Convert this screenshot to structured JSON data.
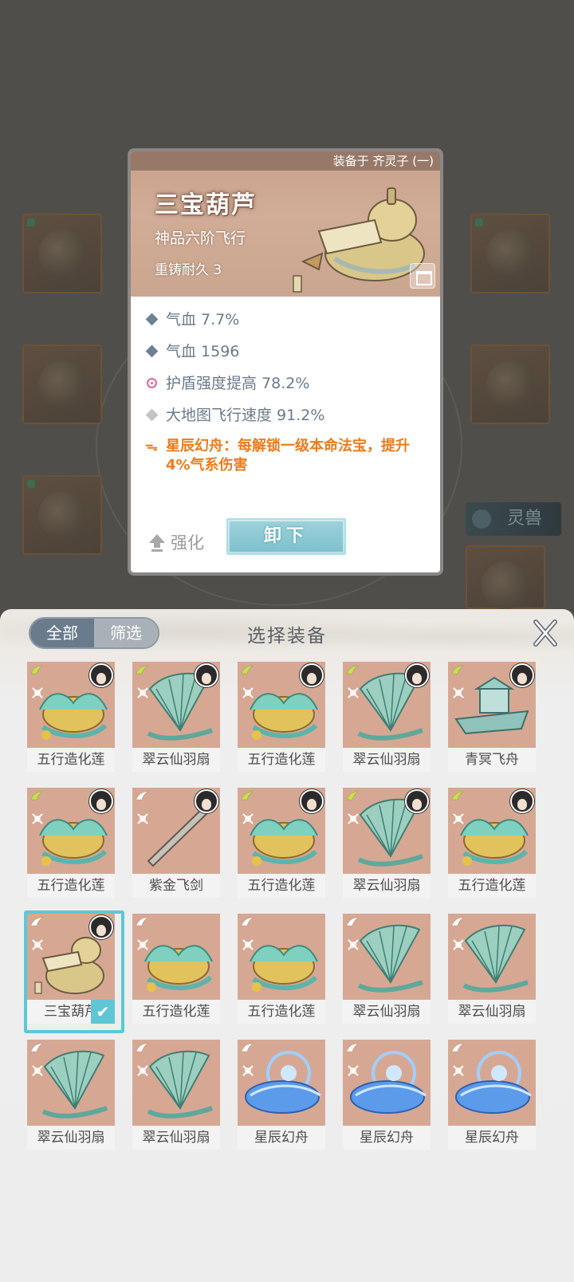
{
  "detail": {
    "equipped_on": "装备于 齐灵子 (一)",
    "name": "三宝葫芦",
    "grade": "神品六阶飞行",
    "durability": "重铸耐久 3",
    "attributes": [
      {
        "marker": "diamond",
        "text": "气血 7.7%"
      },
      {
        "marker": "diamond",
        "text": "气血 1596"
      },
      {
        "marker": "shield",
        "text": "护盾强度提高 78.2%"
      },
      {
        "marker": "diamond-gray",
        "text": "大地图飞行速度 91.2%"
      }
    ],
    "special": "星辰幻舟：每解锁一级本命法宝，提升4%气系伤害",
    "enhance_label": "强化",
    "unequip_label": "卸下"
  },
  "background": {
    "lingshou_label": "灵兽"
  },
  "panel": {
    "tab_all": "全部",
    "tab_filter": "筛选",
    "title": "选择装备",
    "items": [
      {
        "name": "五行造化莲",
        "wing": "#c6e24a",
        "avatar": true,
        "kind": "lotus"
      },
      {
        "name": "翠云仙羽扇",
        "wing": "#c6e24a",
        "avatar": true,
        "kind": "fan"
      },
      {
        "name": "五行造化莲",
        "wing": "#c6e24a",
        "avatar": true,
        "kind": "lotus"
      },
      {
        "name": "翠云仙羽扇",
        "wing": "#c6e24a",
        "avatar": true,
        "kind": "fan"
      },
      {
        "name": "青冥飞舟",
        "wing": "#c6e24a",
        "avatar": true,
        "kind": "boat"
      },
      {
        "name": "五行造化莲",
        "wing": "#c6e24a",
        "avatar": true,
        "kind": "lotus"
      },
      {
        "name": "紫金飞剑",
        "wing": "#ffffff",
        "avatar": true,
        "kind": "sword"
      },
      {
        "name": "五行造化莲",
        "wing": "#c6e24a",
        "avatar": true,
        "kind": "lotus"
      },
      {
        "name": "翠云仙羽扇",
        "wing": "#c6e24a",
        "avatar": true,
        "kind": "fan"
      },
      {
        "name": "五行造化莲",
        "wing": "#c6e24a",
        "avatar": true,
        "kind": "lotus"
      },
      {
        "name": "三宝葫芦",
        "wing": "#ffffff",
        "avatar": true,
        "kind": "gourd",
        "selected": true
      },
      {
        "name": "五行造化莲",
        "wing": "#ffffff",
        "avatar": false,
        "kind": "lotus"
      },
      {
        "name": "五行造化莲",
        "wing": "#ffffff",
        "avatar": false,
        "kind": "lotus"
      },
      {
        "name": "翠云仙羽扇",
        "wing": "#ffffff",
        "avatar": false,
        "kind": "fan"
      },
      {
        "name": "翠云仙羽扇",
        "wing": "#ffffff",
        "avatar": false,
        "kind": "fan"
      },
      {
        "name": "翠云仙羽扇",
        "wing": "#ffffff",
        "avatar": false,
        "kind": "fan"
      },
      {
        "name": "翠云仙羽扇",
        "wing": "#ffffff",
        "avatar": false,
        "kind": "fan"
      },
      {
        "name": "星辰幻舟",
        "wing": "#ffffff",
        "avatar": false,
        "kind": "star"
      },
      {
        "name": "星辰幻舟",
        "wing": "#ffffff",
        "avatar": false,
        "kind": "star"
      },
      {
        "name": "星辰幻舟",
        "wing": "#ffffff",
        "avatar": false,
        "kind": "star"
      }
    ]
  },
  "colors": {
    "accent_teal": "#5fc6d6",
    "special_orange": "#ee7b1a",
    "attr_gray_blue": "#6a7a8a",
    "tile_bg": "#d6a893"
  }
}
